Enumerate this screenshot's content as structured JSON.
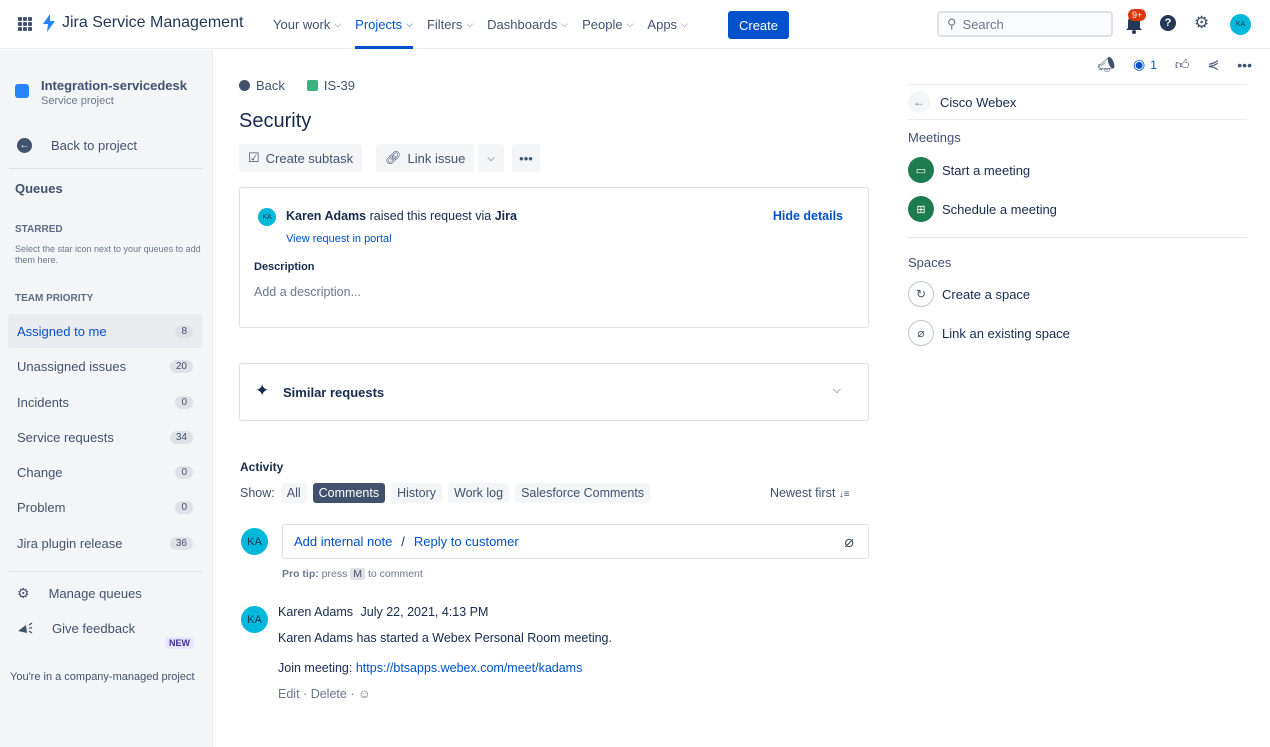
{
  "topbar": {
    "product_name": "Jira Service Management",
    "nav": [
      {
        "label": "Your work",
        "active": false
      },
      {
        "label": "Projects",
        "active": true
      },
      {
        "label": "Filters",
        "active": false
      },
      {
        "label": "Dashboards",
        "active": false
      },
      {
        "label": "People",
        "active": false
      },
      {
        "label": "Apps",
        "active": false
      }
    ],
    "create_label": "Create",
    "search_placeholder": "Search",
    "notification_count": "9+",
    "user_initials": "KA"
  },
  "sidebar": {
    "project_name": "Integration-servicedesk",
    "project_type": "Service project",
    "back_label": "Back to project",
    "queues_heading": "Queues",
    "starred_heading": "STARRED",
    "starred_note": "Select the star icon next to your queues to add them here.",
    "team_priority_heading": "TEAM PRIORITY",
    "queues": [
      {
        "label": "Assigned to me",
        "count": "8",
        "selected": true
      },
      {
        "label": "Unassigned issues",
        "count": "20",
        "selected": false
      },
      {
        "label": "Incidents",
        "count": "0",
        "selected": false
      },
      {
        "label": "Service requests",
        "count": "34",
        "selected": false
      },
      {
        "label": "Change",
        "count": "0",
        "selected": false
      },
      {
        "label": "Problem",
        "count": "0",
        "selected": false
      },
      {
        "label": "Jira plugin release",
        "count": "36",
        "selected": false
      }
    ],
    "manage_queues": "Manage queues",
    "new_badge": "NEW",
    "give_feedback": "Give feedback",
    "footer": "You're in a company-managed project"
  },
  "issue": {
    "back_label": "Back",
    "key": "IS-39",
    "title": "Security",
    "create_subtask": "Create subtask",
    "link_issue": "Link issue",
    "more": "•••",
    "requester": "Karen Adams",
    "raised_via_text": "raised this request via",
    "channel": "Jira",
    "view_portal": "View request in portal",
    "hide_details": "Hide details",
    "description_label": "Description",
    "description_placeholder": "Add a description...",
    "similar_requests": "Similar requests"
  },
  "activity": {
    "heading": "Activity",
    "show_label": "Show:",
    "filters": [
      {
        "label": "All",
        "active": false
      },
      {
        "label": "Comments",
        "active": true
      },
      {
        "label": "History",
        "active": false
      },
      {
        "label": "Work log",
        "active": false
      },
      {
        "label": "Salesforce Comments",
        "active": false
      }
    ],
    "sort_label": "Newest first",
    "add_internal_note": "Add internal note",
    "separator": "/",
    "reply_to_customer": "Reply to customer",
    "protip_prefix": "Pro tip:",
    "protip_press": "press",
    "protip_key": "M",
    "protip_suffix": "to comment",
    "comment": {
      "author": "Karen Adams",
      "timestamp": "July 22, 2021, 4:13 PM",
      "text": "Karen Adams has started a Webex Personal Room meeting.",
      "join_label": "Join meeting:",
      "join_url": "https://btsapps.webex.com/meet/kadams",
      "edit": "Edit",
      "delete": "Delete",
      "dot": "·"
    }
  },
  "right_panel": {
    "watch_count": "1",
    "webex_title": "Cisco Webex",
    "meetings_heading": "Meetings",
    "start_meeting": "Start a meeting",
    "schedule_meeting": "Schedule a meeting",
    "spaces_heading": "Spaces",
    "create_space": "Create a space",
    "link_space": "Link an existing space"
  }
}
